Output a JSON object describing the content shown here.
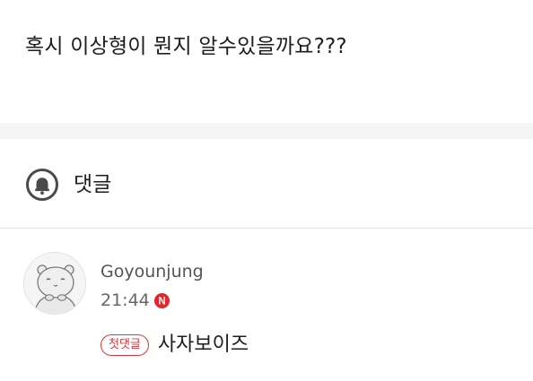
{
  "post": {
    "body_text": "혹시 이상형이 뭔지 알수있을까요???"
  },
  "comments_section": {
    "title": "댓글",
    "header_icon": "bell-icon"
  },
  "comments": [
    {
      "author": "Goyounjung",
      "time": "21:44",
      "new_badge_letter": "N",
      "new_badge_color": "#e3262a",
      "first_comment_badge": "첫댓글",
      "first_comment_badge_color": "#d9383a",
      "text": "사자보이즈",
      "avatar_icon": "default-profile-avatar"
    }
  ]
}
